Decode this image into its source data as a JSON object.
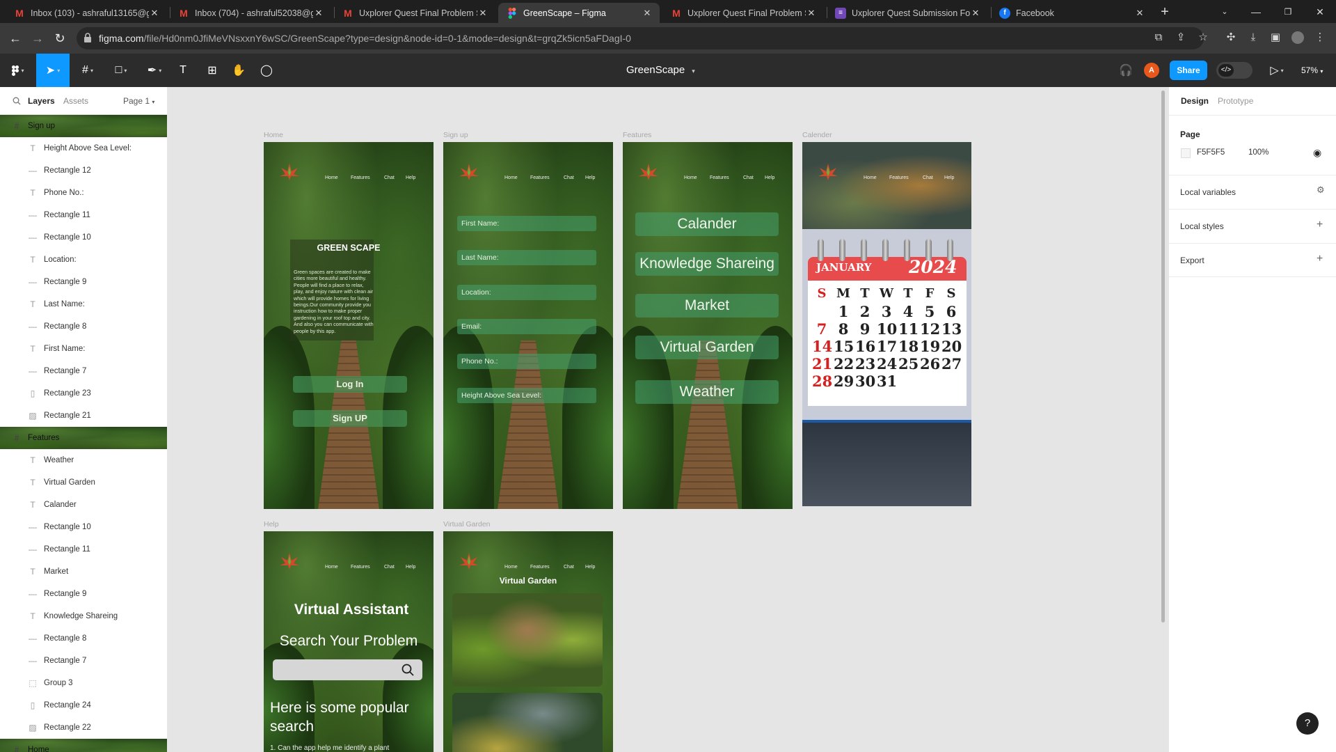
{
  "browser": {
    "tabs": [
      {
        "title": "Inbox (103) - ashraful13165@g",
        "icon": "gmail-icon"
      },
      {
        "title": "Inbox (704) - ashraful52038@g",
        "icon": "gmail-icon"
      },
      {
        "title": "Uxplorer Quest Final Problem S",
        "icon": "gmail-icon"
      },
      {
        "title": "GreenScape – Figma",
        "icon": "figma-icon",
        "active": true
      },
      {
        "title": "Uxplorer Quest Final Problem S",
        "icon": "gmail-icon"
      },
      {
        "title": "Uxplorer Quest Submission For",
        "icon": "forms-icon"
      },
      {
        "title": "Facebook",
        "icon": "facebook-icon"
      }
    ],
    "url_host": "figma.com",
    "url_path": "/file/Hd0nm0JfiMeVNsxxnY6wSC/GreenScape?type=design&node-id=0-1&mode=design&t=grqZk5icn5aFDagI-0"
  },
  "figma": {
    "file_title": "GreenScape",
    "share_label": "Share",
    "avatar_letter": "A",
    "zoom": "57%",
    "left_panel": {
      "tab_layers": "Layers",
      "tab_assets": "Assets",
      "page_selector": "Page 1",
      "layers": [
        {
          "name": "Sign up",
          "type": "frame"
        },
        {
          "name": "Height Above Sea Level:",
          "type": "text"
        },
        {
          "name": "Rectangle 12",
          "type": "rect"
        },
        {
          "name": "Phone No.:",
          "type": "text"
        },
        {
          "name": "Rectangle 11",
          "type": "rect"
        },
        {
          "name": "Rectangle 10",
          "type": "rect"
        },
        {
          "name": "Location:",
          "type": "text"
        },
        {
          "name": "Rectangle 9",
          "type": "rect"
        },
        {
          "name": "Last Name:",
          "type": "text"
        },
        {
          "name": "Rectangle 8",
          "type": "rect"
        },
        {
          "name": "First Name:",
          "type": "text"
        },
        {
          "name": "Rectangle 7",
          "type": "rect"
        },
        {
          "name": "Rectangle 23",
          "type": "vrect"
        },
        {
          "name": "Rectangle 21",
          "type": "image"
        },
        {
          "name": "Features",
          "type": "frame"
        },
        {
          "name": "Weather",
          "type": "text"
        },
        {
          "name": "Virtual Garden",
          "type": "text"
        },
        {
          "name": "Calander",
          "type": "text"
        },
        {
          "name": "Rectangle 10",
          "type": "rect"
        },
        {
          "name": "Rectangle 11",
          "type": "rect"
        },
        {
          "name": "Market",
          "type": "text"
        },
        {
          "name": "Rectangle 9",
          "type": "rect"
        },
        {
          "name": "Knowledge Shareing",
          "type": "text"
        },
        {
          "name": "Rectangle 8",
          "type": "rect"
        },
        {
          "name": "Rectangle 7",
          "type": "rect"
        },
        {
          "name": "Group 3",
          "type": "group"
        },
        {
          "name": "Rectangle 24",
          "type": "vrect"
        },
        {
          "name": "Rectangle 22",
          "type": "image"
        },
        {
          "name": "Home",
          "type": "frame"
        }
      ]
    },
    "right_panel": {
      "tab_design": "Design",
      "tab_prototype": "Prototype",
      "page_label": "Page",
      "page_color": "F5F5F5",
      "page_opacity": "100%",
      "local_variables": "Local variables",
      "local_styles": "Local styles",
      "export": "Export"
    },
    "canvas": {
      "frame_labels": [
        "Home",
        "Sign up",
        "Features",
        "Calender",
        "Help",
        "Virtual Garden"
      ],
      "nav_items": [
        "Home",
        "Features",
        "Chat",
        "Help"
      ],
      "home": {
        "title": "GREEN SCAPE",
        "body": "Green spaces are created to make cities more beautiful and healthy. People will find a place to relax, play, and enjoy nature with clean air which will provide homes for living beings.Our community provide you instruction how to make proper gardening in your roof top and city. And also you can communicate with people by this app.",
        "login": "Log In",
        "signup": "Sign UP"
      },
      "signup_fields": [
        "First Name:",
        "Last Name:",
        "Location:",
        "Email:",
        "Phone No.:",
        "Height Above Sea Level:"
      ],
      "features_buttons": [
        "Calander",
        "Knowledge Shareing",
        "Market",
        "Virtual Garden",
        "Weather"
      ],
      "calendar": {
        "month": "JANUARY",
        "year": "2024",
        "weekdays": [
          "S",
          "M",
          "T",
          "W",
          "T",
          "F",
          "S"
        ],
        "rows": [
          [
            "",
            "1",
            "2",
            "3",
            "4",
            "5",
            "6"
          ],
          [
            "7",
            "8",
            "9",
            "10",
            "11",
            "12",
            "13"
          ],
          [
            "14",
            "15",
            "16",
            "17",
            "18",
            "19",
            "20"
          ],
          [
            "21",
            "22",
            "23",
            "24",
            "25",
            "26",
            "27"
          ],
          [
            "28",
            "29",
            "30",
            "31",
            "",
            "",
            ""
          ]
        ]
      },
      "help": {
        "title": "Virtual Assistant",
        "search_heading": "Search Your Problem",
        "popular": "Here is some popular search",
        "first_question": "1. Can the app help me identify a plant"
      },
      "virtual_garden": {
        "title": "Virtual Garden"
      }
    }
  },
  "colors": {
    "figma_blue": "#0d99ff",
    "avatar": "#e8581c",
    "calendar_red": "#e84b4b"
  }
}
